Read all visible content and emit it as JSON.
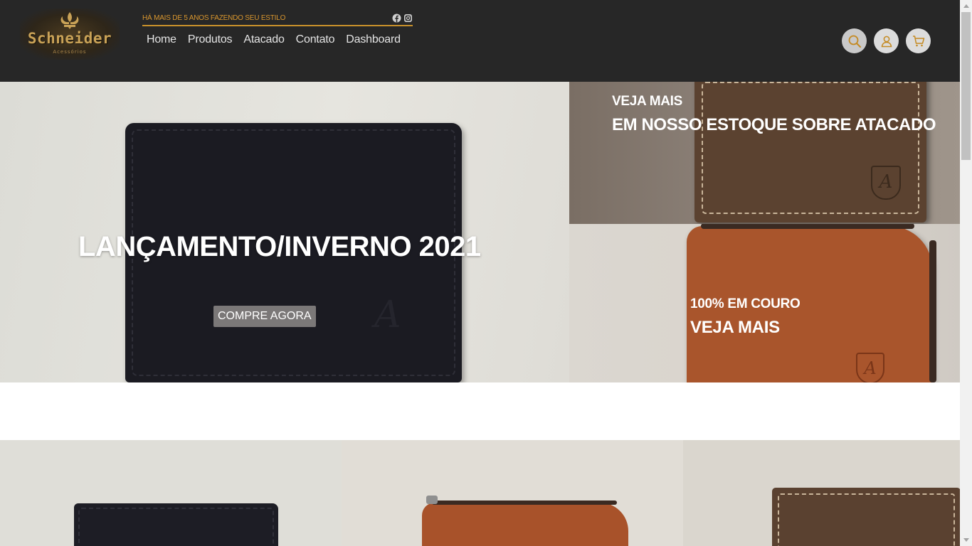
{
  "header": {
    "logo": {
      "brand": "Schneider",
      "subtitle": "Acessórios"
    },
    "tagline": "HÁ MAIS DE 5 ANOS FAZENDO SEU ESTILO",
    "social_icons": [
      "facebook-icon",
      "instagram-icon"
    ],
    "nav": [
      "Home",
      "Produtos",
      "Atacado",
      "Contato",
      "Dashboard"
    ],
    "actions": [
      "search-icon",
      "user-icon",
      "cart-icon"
    ],
    "accent_color": "#c9912b",
    "background_color": "#272727"
  },
  "hero": {
    "title": "LANÇAMENTO/INVERNO 2021",
    "cta": "COMPRE AGORA"
  },
  "promo_top": {
    "small_label": "VEJA MAIS",
    "large_label": "EM NOSSO ESTOQUE SOBRE ATACADO"
  },
  "promo_bottom": {
    "small_label": "100% EM COURO",
    "large_label": "VEJA MAIS"
  }
}
